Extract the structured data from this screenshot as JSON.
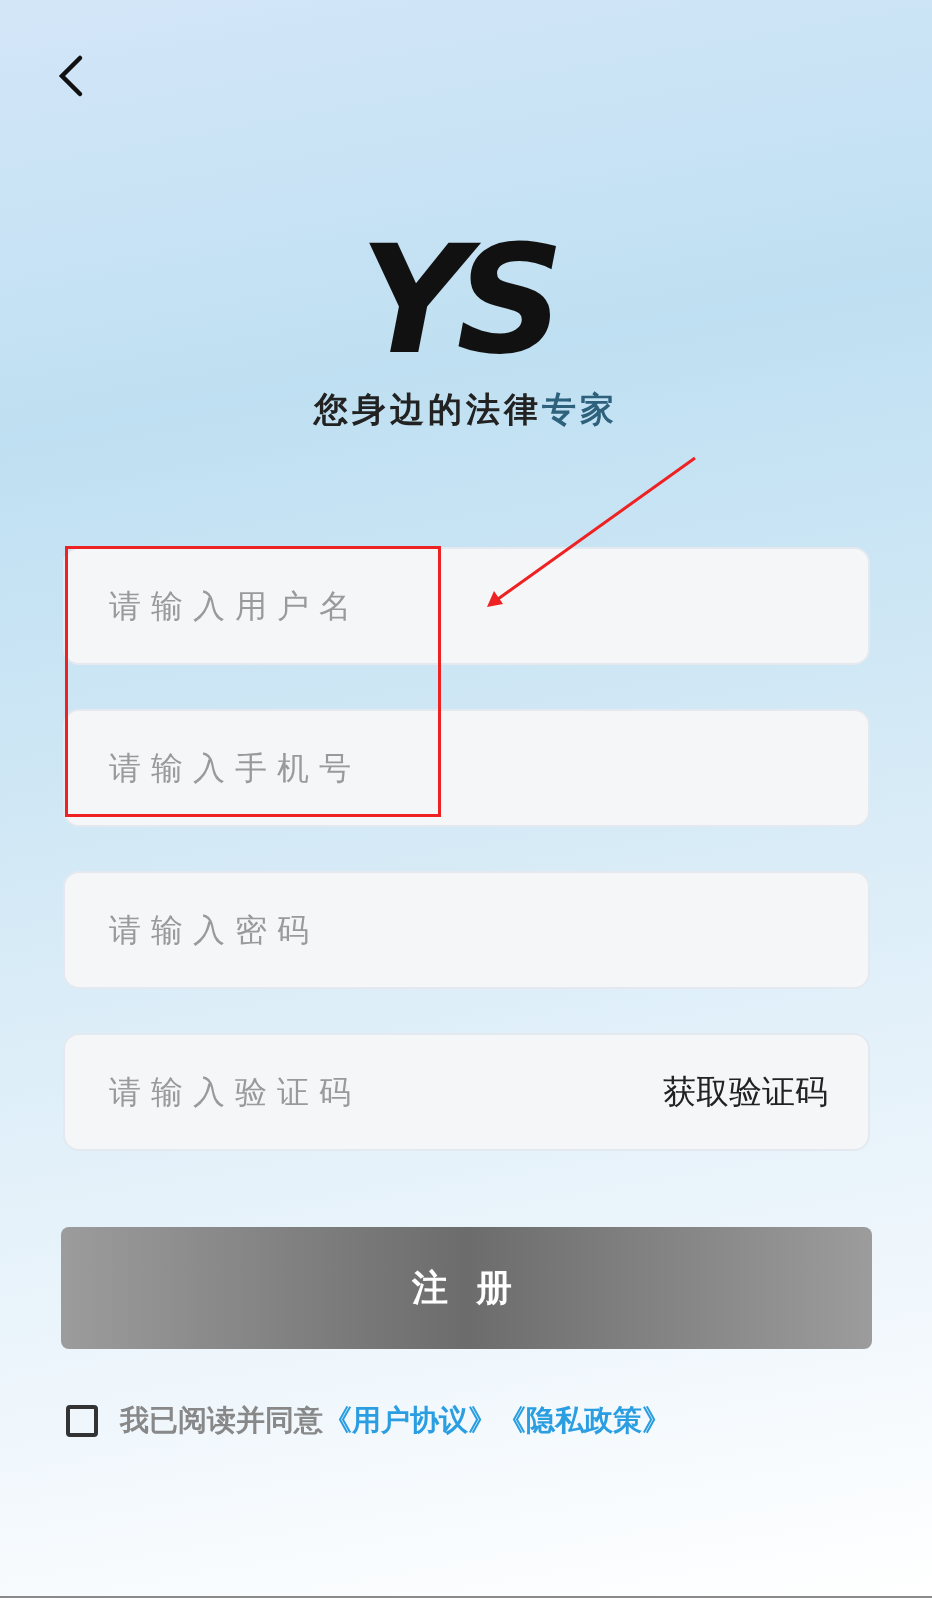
{
  "logo": "YS",
  "tagline": {
    "main": "您身边的法律",
    "accent": "专家"
  },
  "fields": [
    {
      "placeholder": "请输入用户名"
    },
    {
      "placeholder": "请输入手机号"
    },
    {
      "placeholder": "请输入密码"
    },
    {
      "placeholder": "请输入验证码",
      "action": "获取验证码"
    }
  ],
  "submit": "注 册",
  "agreement": {
    "checked": false,
    "text": "我已阅读并同意",
    "links": [
      "《用户协议》",
      "《隐私政策》"
    ]
  },
  "annotation_box": true,
  "annotation_arrow": true
}
